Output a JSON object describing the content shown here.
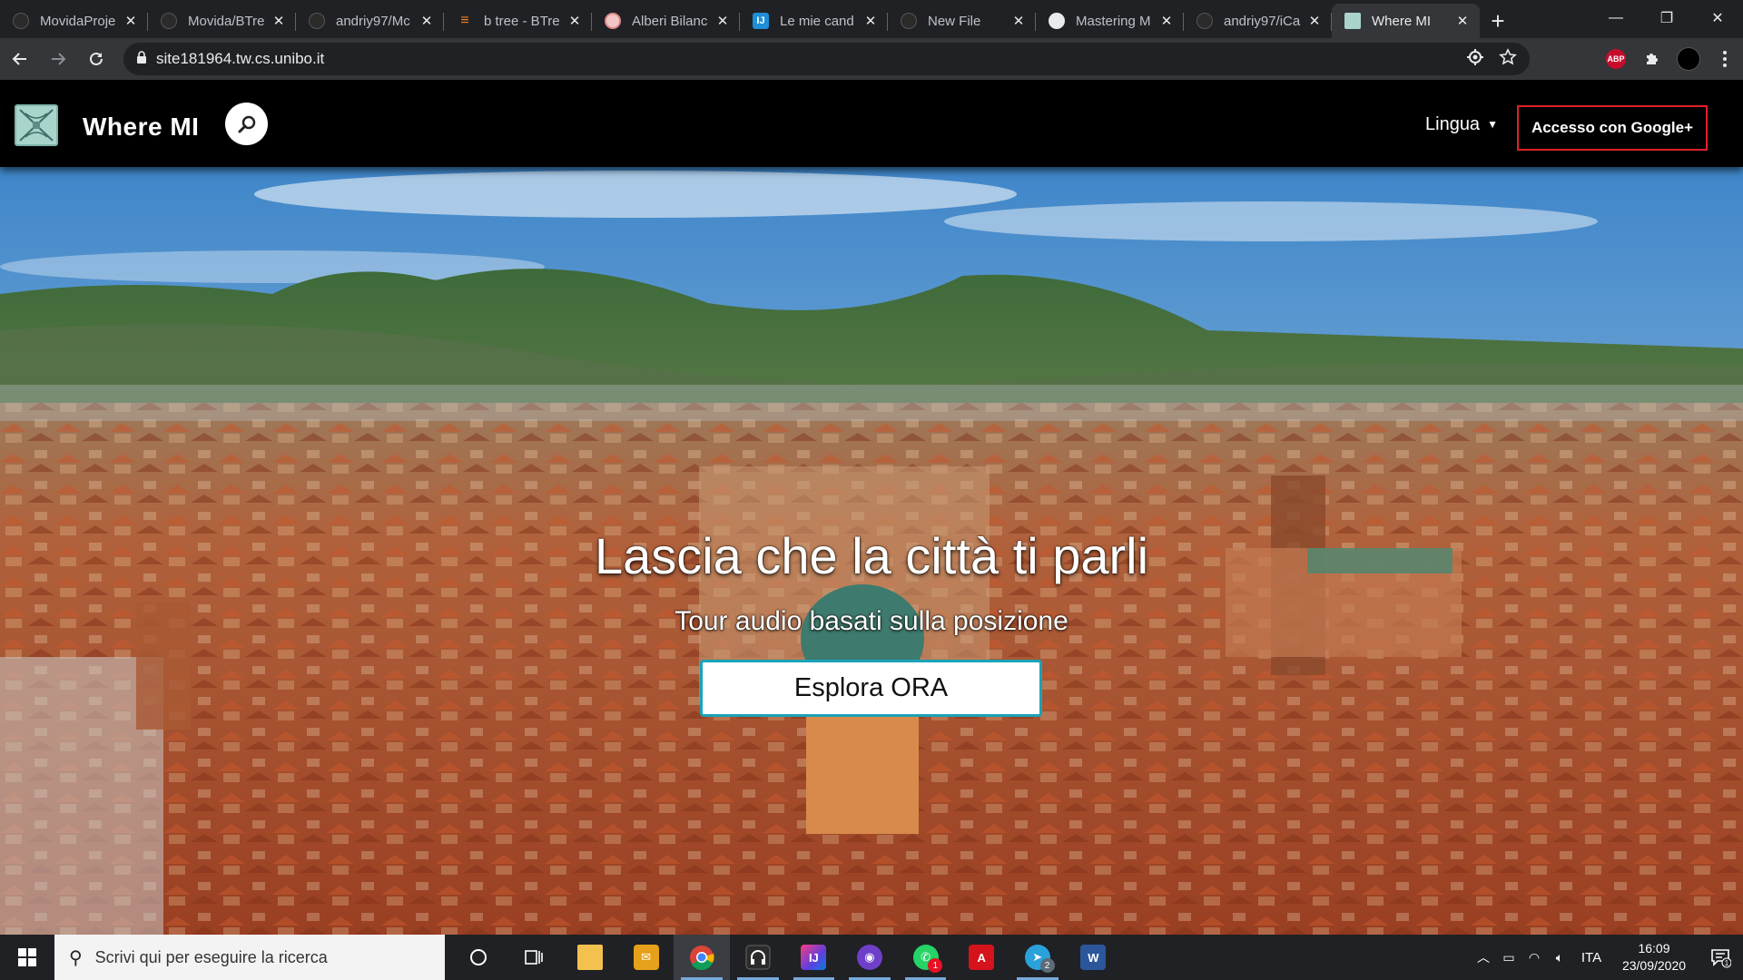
{
  "browser": {
    "tabs": [
      {
        "title": "MovidaProje",
        "favicon": "github-icon",
        "active": false
      },
      {
        "title": "Movida/BTre",
        "favicon": "github-icon",
        "active": false
      },
      {
        "title": "andriy97/Mc",
        "favicon": "github-icon",
        "active": false
      },
      {
        "title": "b tree - BTre",
        "favicon": "stackoverflow-icon",
        "active": false
      },
      {
        "title": "Alberi Bilanc",
        "favicon": "page-icon",
        "active": false
      },
      {
        "title": "Le mie cand",
        "favicon": "intellij-icon",
        "active": false
      },
      {
        "title": "New File",
        "favicon": "github-icon",
        "active": false
      },
      {
        "title": "Mastering M",
        "favicon": "github-icon",
        "active": false
      },
      {
        "title": "andriy97/iCa",
        "favicon": "github-icon",
        "active": false
      },
      {
        "title": "Where MI",
        "favicon": "wheremi-icon",
        "active": true
      }
    ],
    "url": "site181964.tw.cs.unibo.it",
    "abp_label": "ABP"
  },
  "site": {
    "brand": "Where MI",
    "language_label": "Lingua",
    "google_login_label": "Accesso con Google+",
    "hero_title": "Lascia che la città ti parli",
    "hero_subtitle": "Tour audio basati sulla posizione",
    "cta_label": "Esplora ORA"
  },
  "taskbar": {
    "search_placeholder": "Scrivi qui per eseguire la ricerca",
    "apps": [
      {
        "name": "cortana-icon",
        "open": false
      },
      {
        "name": "task-view-icon",
        "open": false
      },
      {
        "name": "file-explorer-icon",
        "open": false
      },
      {
        "name": "outlook-icon",
        "open": false
      },
      {
        "name": "chrome-icon",
        "open": true,
        "active": true
      },
      {
        "name": "headphones-icon",
        "open": true
      },
      {
        "name": "intellij-icon",
        "open": true
      },
      {
        "name": "github-desktop-icon",
        "open": true
      },
      {
        "name": "whatsapp-icon",
        "open": true,
        "badge": "1"
      },
      {
        "name": "acrobat-icon",
        "open": false
      },
      {
        "name": "telegram-icon",
        "open": true,
        "badge": "2"
      },
      {
        "name": "word-icon",
        "open": false
      }
    ],
    "language": "ITA",
    "time": "16:09",
    "date": "23/09/2020",
    "notification_count": "1"
  },
  "colors": {
    "chrome_dark": "#202124",
    "chrome_toolbar": "#35363a",
    "google_btn_border": "#e0202a",
    "cta_border": "#1aa3b8",
    "logo_bg": "#a9d4cc"
  }
}
